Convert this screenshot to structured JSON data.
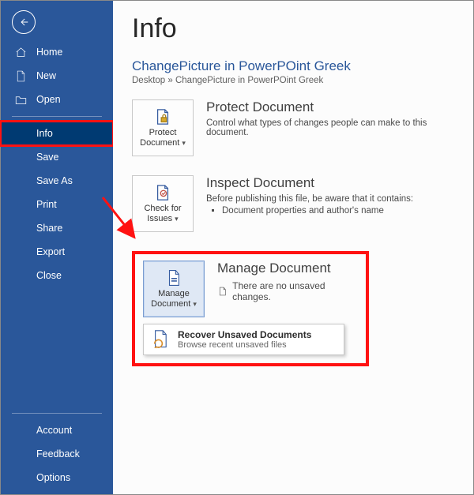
{
  "sidebar": {
    "items": [
      {
        "label": "Home"
      },
      {
        "label": "New"
      },
      {
        "label": "Open"
      },
      {
        "label": "Info"
      },
      {
        "label": "Save"
      },
      {
        "label": "Save As"
      },
      {
        "label": "Print"
      },
      {
        "label": "Share"
      },
      {
        "label": "Export"
      },
      {
        "label": "Close"
      }
    ],
    "bottom": [
      {
        "label": "Account"
      },
      {
        "label": "Feedback"
      },
      {
        "label": "Options"
      }
    ]
  },
  "page": {
    "title": "Info",
    "doc_title": "ChangePicture in PowerPOint Greek",
    "breadcrumb": "Desktop » ChangePicture in PowerPOint Greek"
  },
  "protect": {
    "tile": "Protect Document",
    "heading": "Protect Document",
    "desc": "Control what types of changes people can make to this document."
  },
  "inspect": {
    "tile": "Check for Issues",
    "heading": "Inspect Document",
    "desc": "Before publishing this file, be aware that it contains:",
    "bullet": "Document properties and author's name"
  },
  "manage": {
    "tile": "Manage Document",
    "heading": "Manage Document",
    "status": "There are no unsaved changes.",
    "dropdown_title": "Recover Unsaved Documents",
    "dropdown_sub": "Browse recent unsaved files"
  }
}
